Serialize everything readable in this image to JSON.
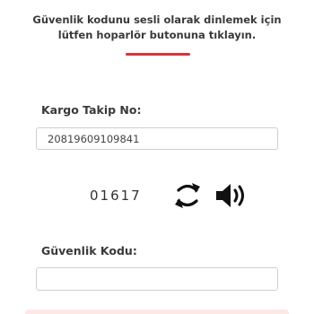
{
  "instruction_text": "Güvenlik kodunu sesli olarak dinlemek için lütfen hoparlör butonuna tıklayın.",
  "tracking": {
    "label": "Kargo Takip No:",
    "value": "20819609109841"
  },
  "captcha": {
    "code": "01617",
    "refresh_icon": "refresh-icon",
    "speaker_icon": "speaker-icon"
  },
  "security": {
    "label": "Güvenlik Kodu:",
    "value": ""
  },
  "colors": {
    "accent_red": "#d8343c",
    "text_dark": "#3a3a3a",
    "field_border": "#cfcfcf"
  }
}
